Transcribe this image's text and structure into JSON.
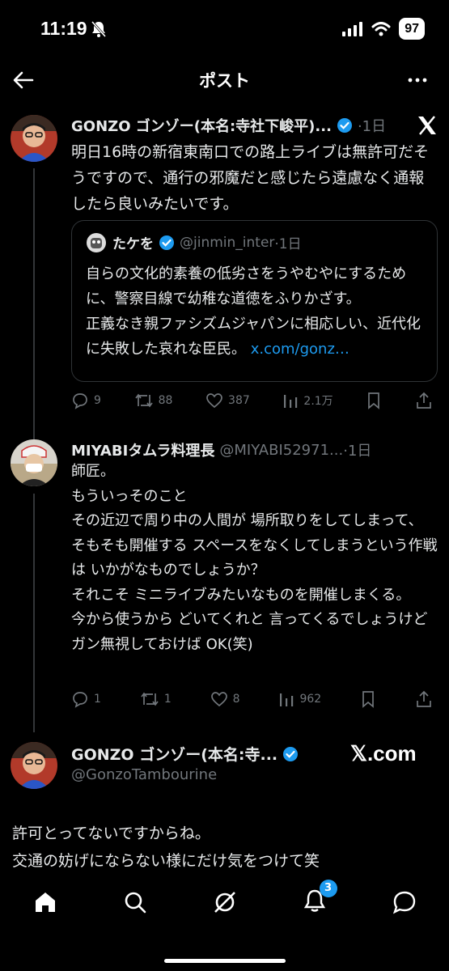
{
  "status_bar": {
    "time": "11:19",
    "battery": "97"
  },
  "nav": {
    "title": "ポスト"
  },
  "post1": {
    "name": "GONZO ゴンゾー(本名:寺社下峻平)...",
    "time": "·1日",
    "text": "明日16時の新宿東南口での路上ライブは無許可だそうですので、通行の邪魔だと感じたら遠慮なく通報したら良いみたいです。",
    "quote": {
      "name": "たケを",
      "handle": "@jinmin_inter",
      "time": "·1日",
      "text": "自らの文化的素養の低劣さをうやむやにするために、警察目線で幼稚な道徳をふりかざす。",
      "text2": "正義なき親ファシズムジャパンに相応しい、近代化に失敗した哀れな臣民。",
      "link": "x.com/gonz…"
    },
    "replies": "9",
    "reposts": "88",
    "likes": "387",
    "views": "2.1万"
  },
  "post2": {
    "name": "MIYABIタムラ料理長",
    "handle": "@MIYABI52971...",
    "time": "·1日",
    "lines": [
      "師匠。",
      "もういっそのこと",
      "その近辺で周り中の人間が 場所取りをしてしまって、",
      "そもそも開催する スペースをなくしてしまうという作戦は いかがなものでしょうか？",
      "それこそ ミニライブみたいなものを開催しまくる。",
      "今から使うから どいてくれと 言ってくるでしょうけどガン無視しておけば OK(笑)"
    ],
    "replies": "1",
    "reposts": "1",
    "likes": "8",
    "views": "962"
  },
  "embed": {
    "name": "GONZO ゴンゾー(本名:寺...",
    "handle": "@GonzoTambourine",
    "watermark": "𝕏.com",
    "line1": "許可とってないですからね。",
    "line2": "交通の妨げにならない様にだけ気をつけて笑"
  },
  "bottom_nav": {
    "notification_count": "3"
  },
  "colors": {
    "background": "#000000",
    "text": "#e7e9ea",
    "muted": "#71767b",
    "accent": "#1d9bf0"
  }
}
